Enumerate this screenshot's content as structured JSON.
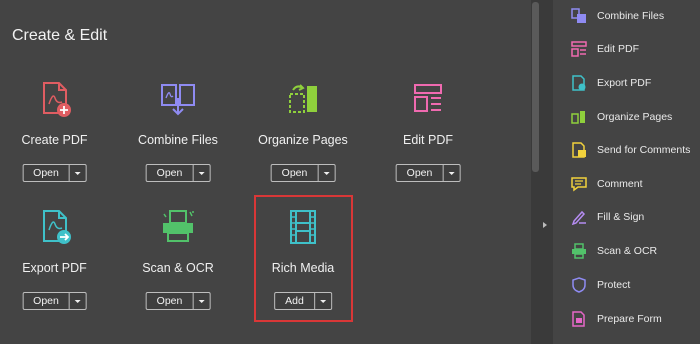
{
  "section_title": "Create & Edit",
  "tools": [
    {
      "label": "Create PDF",
      "button": "Open",
      "icon": "create-pdf-icon",
      "color": "#e05d62"
    },
    {
      "label": "Combine Files",
      "button": "Open",
      "icon": "combine-files-icon",
      "color": "#8f8bf2"
    },
    {
      "label": "Organize Pages",
      "button": "Open",
      "icon": "organize-pages-icon",
      "color": "#8fd03c"
    },
    {
      "label": "Edit PDF",
      "button": "Open",
      "icon": "edit-pdf-icon",
      "color": "#f06ab0"
    },
    {
      "label": "Export PDF",
      "button": "Open",
      "icon": "export-pdf-icon",
      "color": "#3fc1c9"
    },
    {
      "label": "Scan & OCR",
      "button": "Open",
      "icon": "scan-ocr-icon",
      "color": "#52c26a"
    },
    {
      "label": "Rich Media",
      "button": "Add",
      "icon": "rich-media-icon",
      "color": "#3fc1c9"
    }
  ],
  "sidebar": [
    {
      "label": "Combine Files",
      "icon": "combine-files-icon",
      "color": "#8f8bf2"
    },
    {
      "label": "Edit PDF",
      "icon": "edit-pdf-icon",
      "color": "#f06ab0"
    },
    {
      "label": "Export PDF",
      "icon": "export-pdf-icon",
      "color": "#3fc1c9"
    },
    {
      "label": "Organize Pages",
      "icon": "organize-pages-icon",
      "color": "#8fd03c"
    },
    {
      "label": "Send for Comments",
      "icon": "send-for-comments-icon",
      "color": "#f2d23c"
    },
    {
      "label": "Comment",
      "icon": "comment-icon",
      "color": "#f2d23c"
    },
    {
      "label": "Fill & Sign",
      "icon": "fill-sign-icon",
      "color": "#b58cf2"
    },
    {
      "label": "Scan & OCR",
      "icon": "scan-ocr-icon",
      "color": "#52c26a"
    },
    {
      "label": "Protect",
      "icon": "protect-icon",
      "color": "#8f8bf2"
    },
    {
      "label": "Prepare Form",
      "icon": "prepare-form-icon",
      "color": "#e566c7"
    }
  ]
}
